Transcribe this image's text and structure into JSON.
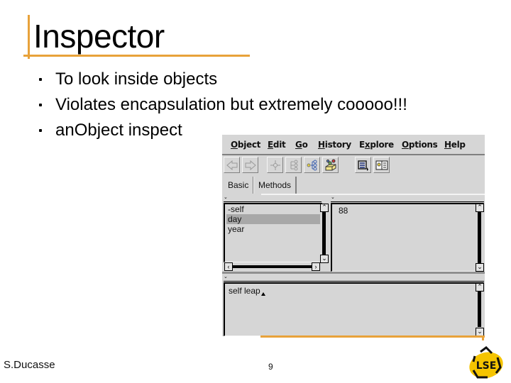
{
  "slide": {
    "title": "Inspector",
    "bullets": [
      "To look inside objects",
      "Violates encapsulation but extremely cooooo!!!",
      "anObject inspect"
    ],
    "author": "S.Ducasse",
    "page_number": "9",
    "logo_text": "LSE",
    "accent_color": "#e8a23a"
  },
  "inspector": {
    "menus": [
      {
        "mnemonic": "O",
        "rest": "bject"
      },
      {
        "mnemonic": "E",
        "rest": "dit"
      },
      {
        "mnemonic": "G",
        "rest": "o"
      },
      {
        "mnemonic": "H",
        "rest": "istory"
      },
      {
        "mnemonic": "",
        "pre": "E",
        "mid": "x",
        "rest": "plore"
      },
      {
        "mnemonic": "O",
        "rest": "ptions"
      },
      {
        "mnemonic": "H",
        "rest": "elp"
      }
    ],
    "toolbar": [
      {
        "icon": "back-arrow-icon",
        "enabled": false
      },
      {
        "icon": "forward-arrow-icon",
        "enabled": false
      },
      {
        "icon": "dive-icon",
        "enabled": false
      },
      {
        "icon": "hierarchy-icon",
        "enabled": false
      },
      {
        "icon": "explore-tree-icon",
        "enabled": true
      },
      {
        "icon": "sandbox-icon",
        "enabled": true
      },
      {
        "icon": "list-pointer-icon",
        "enabled": true
      },
      {
        "icon": "browse-book-icon",
        "enabled": true
      }
    ],
    "tabs": [
      {
        "label": "Basic",
        "active": true
      },
      {
        "label": "Methods",
        "active": false
      }
    ],
    "fields": [
      {
        "name": "-self",
        "selected": false
      },
      {
        "name": "day",
        "selected": true
      },
      {
        "name": "year",
        "selected": false
      }
    ],
    "value": "88",
    "workspace_text": "self leap",
    "selection_color": "#a8a8a8",
    "window_color": "#d6d6d6"
  }
}
